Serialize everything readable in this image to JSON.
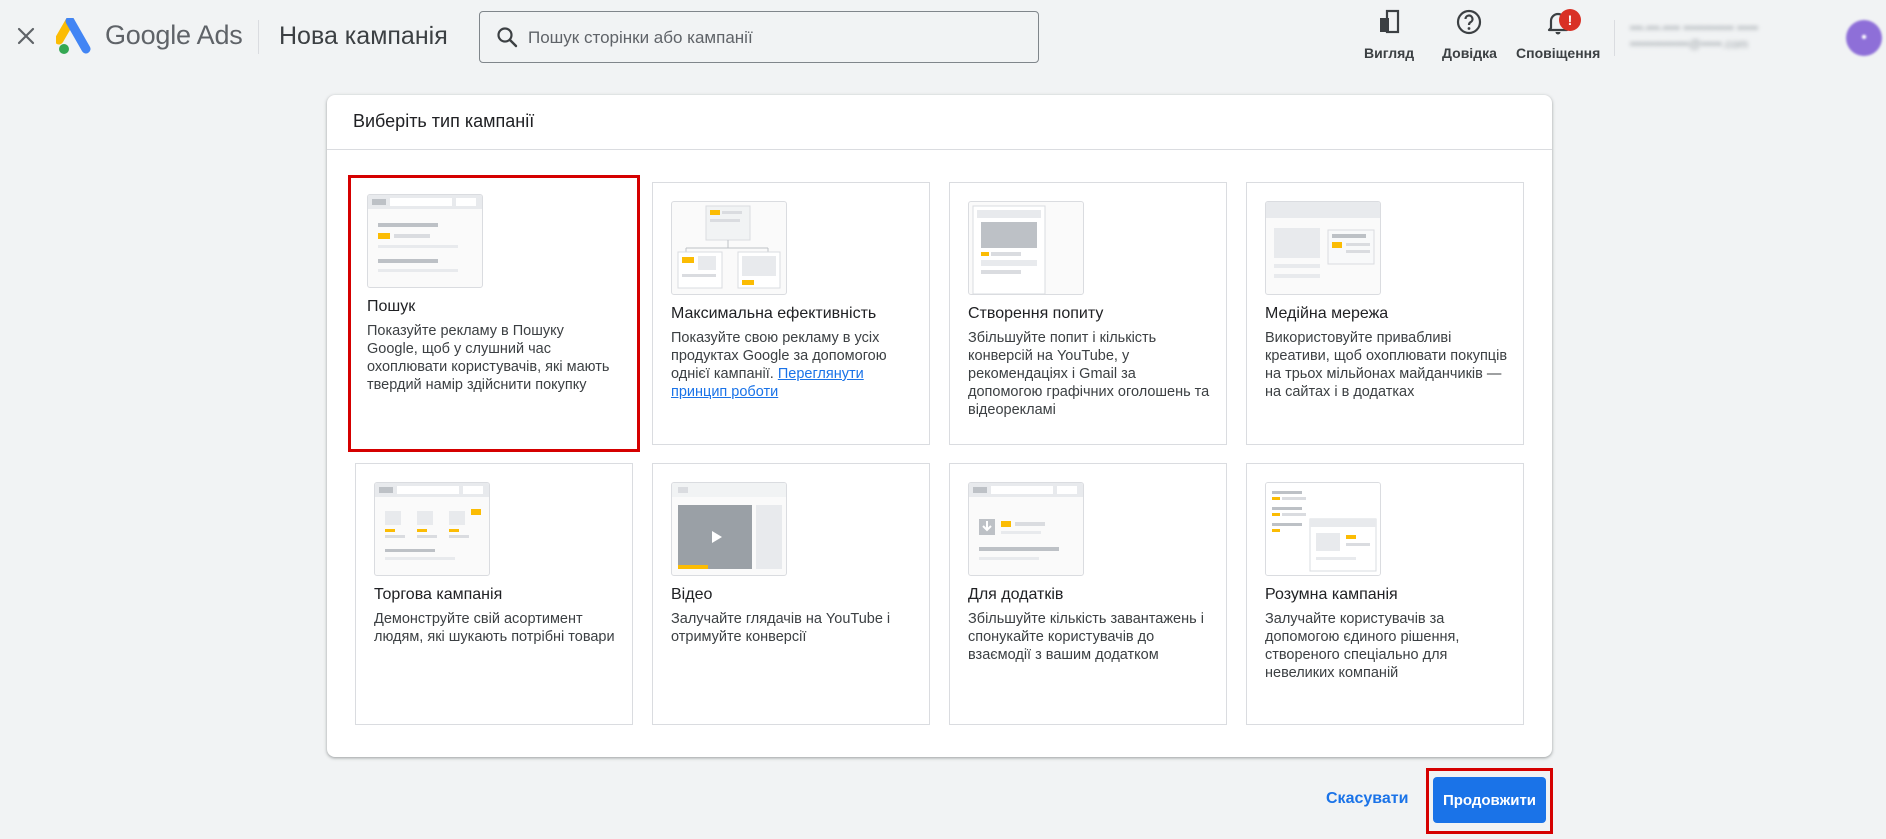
{
  "header": {
    "brand": "Google Ads",
    "page_title": "Нова кампанія",
    "search_placeholder": "Пошук сторінки або кампанії",
    "actions": {
      "view": "Вигляд",
      "help": "Довідка",
      "notifications": "Сповіщення",
      "notifications_badge": "!"
    },
    "account": {
      "line1": "•••-•••-•••• •••••••••••• •••••",
      "line2": "••••••••••••••@•••••.com",
      "avatar": "•"
    }
  },
  "panel": {
    "title": "Виберіть тип кампанії"
  },
  "cards": [
    {
      "title": "Пошук",
      "desc": "Показуйте рекламу в Пошуку Google, щоб у слушний час охоплювати користувачів, які мають твердий намір здійснити покупку"
    },
    {
      "title": "Максимальна ефективність",
      "desc": "Показуйте свою рекламу в усіх продуктах Google за допомогою однієї кампанії. ",
      "link": "Переглянути принцип роботи"
    },
    {
      "title": "Створення попиту",
      "desc": "Збільшуйте попит і кількість конверсій на YouTube, у рекомендаціях і Gmail за допомогою графічних оголошень та відеорекламі"
    },
    {
      "title": "Медійна мережа",
      "desc": "Використовуйте привабливі креативи, щоб охоплювати покупців на трьох мільйонах майданчиків — на сайтах і в додатках"
    },
    {
      "title": "Торгова кампанія",
      "desc": "Демонструйте свій асортимент людям, які шукають потрібні товари"
    },
    {
      "title": "Відео",
      "desc": "Залучайте глядачів на YouTube і отримуйте конверсії"
    },
    {
      "title": "Для додатків",
      "desc": "Збільшуйте кількість завантажень і спонукайте користувачів до взаємодії з вашим додатком"
    },
    {
      "title": "Розумна кампанія",
      "desc": "Залучайте користувачів за допомогою єдиного рішення, створеного спеціально для невеликих компаній"
    }
  ],
  "footer": {
    "cancel": "Скасувати",
    "continue": "Продовжити"
  },
  "colors": {
    "accent": "#1a73e8",
    "highlight": "#d50000",
    "illus_yellow": "#fbbc04"
  }
}
